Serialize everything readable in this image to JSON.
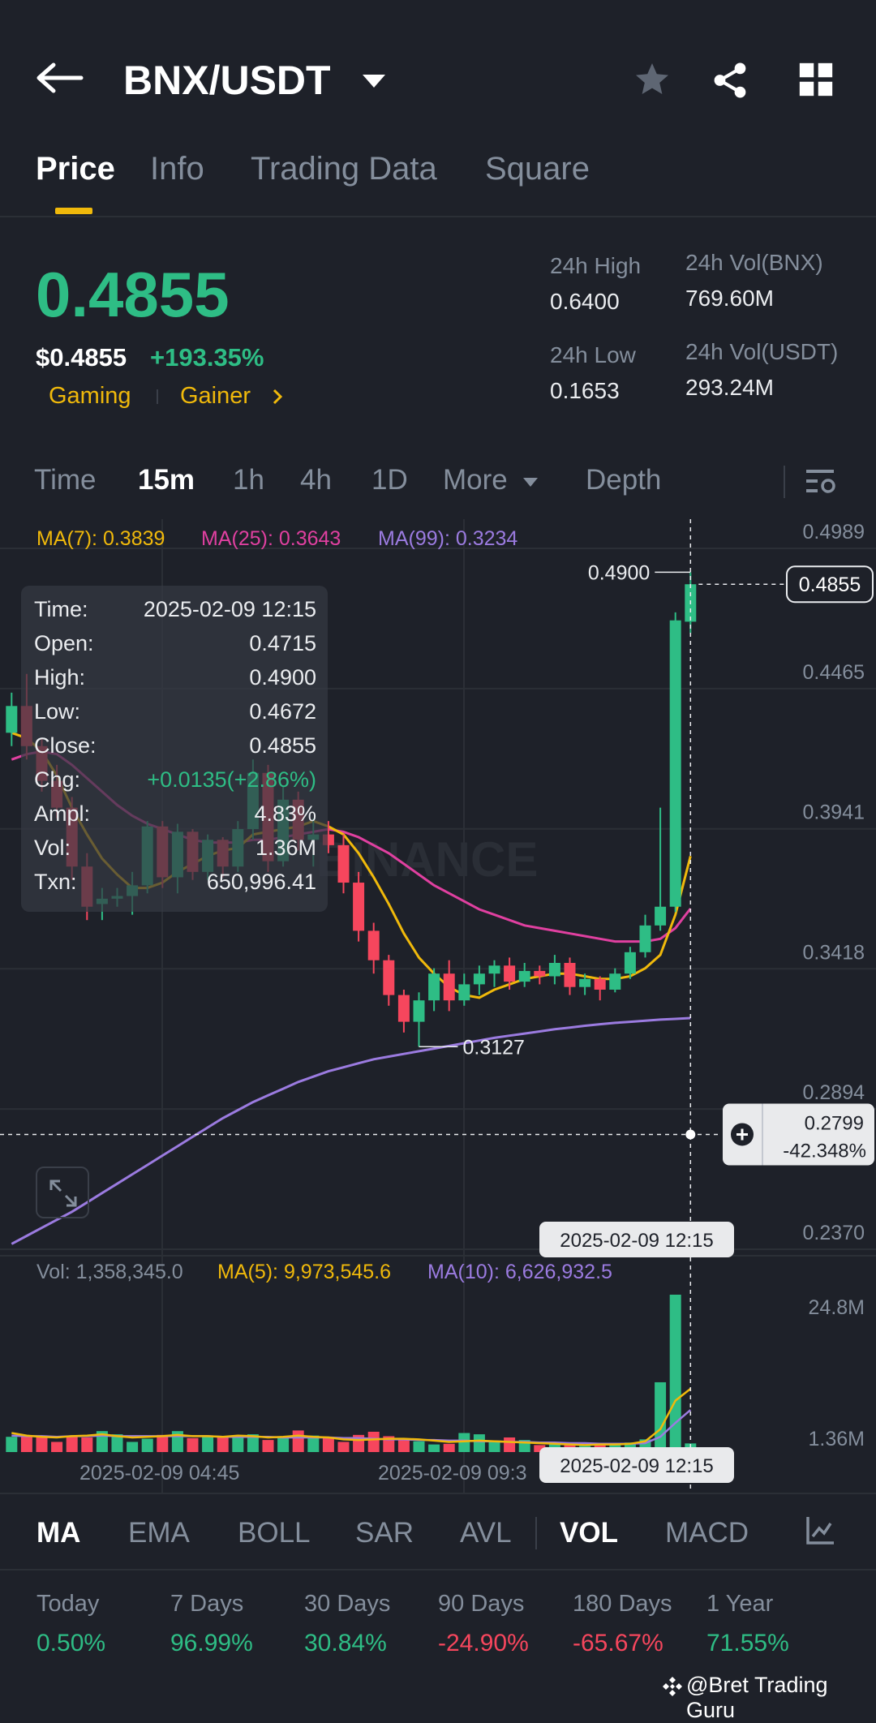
{
  "header": {
    "pair": "BNX/USDT"
  },
  "tabs": [
    {
      "label": "Price",
      "active": true
    },
    {
      "label": "Info",
      "active": false
    },
    {
      "label": "Trading Data",
      "active": false
    },
    {
      "label": "Square",
      "active": false
    }
  ],
  "ticker": {
    "last_price": "0.4855",
    "usd_price": "$0.4855",
    "change": "+193.35%",
    "tags": [
      "Gaming",
      "Gainer"
    ],
    "high_label": "24h High",
    "high": "0.6400",
    "low_label": "24h Low",
    "low": "0.1653",
    "vol_base_label": "24h Vol(BNX)",
    "vol_base": "769.60M",
    "vol_quote_label": "24h Vol(USDT)",
    "vol_quote": "293.24M"
  },
  "timeframes": {
    "items": [
      "Time",
      "15m",
      "1h",
      "4h",
      "1D",
      "More",
      "Depth"
    ],
    "active": "15m"
  },
  "ma_legend": {
    "ma7": "MA(7): 0.3839",
    "ma25": "MA(25): 0.3643",
    "ma99": "MA(99): 0.3234"
  },
  "colors": {
    "up": "#2ebd85",
    "down": "#f6465d",
    "ma7": "#f0b90b",
    "ma25": "#e040a0",
    "ma99": "#9b7be0",
    "accent": "#f0b90b"
  },
  "tooltip": {
    "rows": [
      {
        "label": "Time:",
        "value": "2025-02-09 12:15"
      },
      {
        "label": "Open:",
        "value": "0.4715"
      },
      {
        "label": "High:",
        "value": "0.4900"
      },
      {
        "label": "Low:",
        "value": "0.4672"
      },
      {
        "label": "Close:",
        "value": "0.4855"
      },
      {
        "label": "Chg:",
        "value": "+0.0135(+2.86%)"
      },
      {
        "label": "Ampl:",
        "value": "4.83%"
      },
      {
        "label": "Vol:",
        "value": "1.36M"
      },
      {
        "label": "Txn:",
        "value": "650,996.41"
      }
    ]
  },
  "chart_data": {
    "type": "candlestick",
    "watermark": "BINANCE",
    "price_axis_ticks": [
      "0.4989",
      "0.4465",
      "0.3941",
      "0.3418",
      "0.2894",
      "0.2370"
    ],
    "y_range": [
      0.237,
      0.4989
    ],
    "last_price_tag": "0.4855",
    "high_marker": "0.4900",
    "low_marker": "0.3127",
    "crosshair_price": "0.2799",
    "crosshair_pct": "-42.348%",
    "crosshair_time": "2025-02-09 12:15",
    "candles": [
      {
        "o": 0.43,
        "h": 0.445,
        "l": 0.425,
        "c": 0.44
      },
      {
        "o": 0.44,
        "h": 0.452,
        "l": 0.42,
        "c": 0.425
      },
      {
        "o": 0.425,
        "h": 0.428,
        "l": 0.408,
        "c": 0.412
      },
      {
        "o": 0.412,
        "h": 0.418,
        "l": 0.398,
        "c": 0.402
      },
      {
        "o": 0.402,
        "h": 0.406,
        "l": 0.375,
        "c": 0.38
      },
      {
        "o": 0.38,
        "h": 0.385,
        "l": 0.36,
        "c": 0.365
      },
      {
        "o": 0.366,
        "h": 0.372,
        "l": 0.36,
        "c": 0.368
      },
      {
        "o": 0.368,
        "h": 0.372,
        "l": 0.365,
        "c": 0.369
      },
      {
        "o": 0.369,
        "h": 0.378,
        "l": 0.362,
        "c": 0.373
      },
      {
        "o": 0.373,
        "h": 0.397,
        "l": 0.37,
        "c": 0.395
      },
      {
        "o": 0.395,
        "h": 0.397,
        "l": 0.372,
        "c": 0.376
      },
      {
        "o": 0.376,
        "h": 0.396,
        "l": 0.37,
        "c": 0.393
      },
      {
        "o": 0.393,
        "h": 0.394,
        "l": 0.375,
        "c": 0.378
      },
      {
        "o": 0.378,
        "h": 0.392,
        "l": 0.375,
        "c": 0.39
      },
      {
        "o": 0.39,
        "h": 0.391,
        "l": 0.376,
        "c": 0.38
      },
      {
        "o": 0.38,
        "h": 0.397,
        "l": 0.378,
        "c": 0.394
      },
      {
        "o": 0.394,
        "h": 0.42,
        "l": 0.39,
        "c": 0.415
      },
      {
        "o": 0.415,
        "h": 0.418,
        "l": 0.378,
        "c": 0.382
      },
      {
        "o": 0.382,
        "h": 0.41,
        "l": 0.38,
        "c": 0.405
      },
      {
        "o": 0.405,
        "h": 0.408,
        "l": 0.386,
        "c": 0.39
      },
      {
        "o": 0.39,
        "h": 0.398,
        "l": 0.38,
        "c": 0.392
      },
      {
        "o": 0.392,
        "h": 0.397,
        "l": 0.385,
        "c": 0.388
      },
      {
        "o": 0.388,
        "h": 0.392,
        "l": 0.37,
        "c": 0.374
      },
      {
        "o": 0.374,
        "h": 0.378,
        "l": 0.352,
        "c": 0.356
      },
      {
        "o": 0.356,
        "h": 0.359,
        "l": 0.34,
        "c": 0.345
      },
      {
        "o": 0.345,
        "h": 0.347,
        "l": 0.328,
        "c": 0.332
      },
      {
        "o": 0.332,
        "h": 0.334,
        "l": 0.318,
        "c": 0.322
      },
      {
        "o": 0.322,
        "h": 0.333,
        "l": 0.3127,
        "c": 0.33
      },
      {
        "o": 0.33,
        "h": 0.342,
        "l": 0.326,
        "c": 0.34
      },
      {
        "o": 0.34,
        "h": 0.345,
        "l": 0.326,
        "c": 0.33
      },
      {
        "o": 0.33,
        "h": 0.34,
        "l": 0.328,
        "c": 0.336
      },
      {
        "o": 0.336,
        "h": 0.343,
        "l": 0.332,
        "c": 0.34
      },
      {
        "o": 0.34,
        "h": 0.345,
        "l": 0.335,
        "c": 0.343
      },
      {
        "o": 0.343,
        "h": 0.346,
        "l": 0.334,
        "c": 0.337
      },
      {
        "o": 0.337,
        "h": 0.344,
        "l": 0.335,
        "c": 0.341
      },
      {
        "o": 0.341,
        "h": 0.343,
        "l": 0.336,
        "c": 0.339
      },
      {
        "o": 0.339,
        "h": 0.347,
        "l": 0.336,
        "c": 0.344
      },
      {
        "o": 0.344,
        "h": 0.346,
        "l": 0.332,
        "c": 0.335
      },
      {
        "o": 0.335,
        "h": 0.34,
        "l": 0.332,
        "c": 0.338
      },
      {
        "o": 0.338,
        "h": 0.339,
        "l": 0.33,
        "c": 0.334
      },
      {
        "o": 0.334,
        "h": 0.342,
        "l": 0.333,
        "c": 0.34
      },
      {
        "o": 0.34,
        "h": 0.35,
        "l": 0.338,
        "c": 0.348
      },
      {
        "o": 0.348,
        "h": 0.362,
        "l": 0.346,
        "c": 0.358
      },
      {
        "o": 0.358,
        "h": 0.402,
        "l": 0.356,
        "c": 0.365
      },
      {
        "o": 0.365,
        "h": 0.475,
        "l": 0.363,
        "c": 0.472
      },
      {
        "o": 0.4715,
        "h": 0.49,
        "l": 0.4672,
        "c": 0.4855
      }
    ],
    "ma7": [
      0.43,
      0.428,
      0.423,
      0.414,
      0.402,
      0.392,
      0.383,
      0.377,
      0.372,
      0.372,
      0.374,
      0.378,
      0.381,
      0.384,
      0.386,
      0.387,
      0.392,
      0.393,
      0.394,
      0.395,
      0.397,
      0.395,
      0.392,
      0.385,
      0.376,
      0.366,
      0.355,
      0.346,
      0.34,
      0.335,
      0.332,
      0.331,
      0.334,
      0.336,
      0.338,
      0.339,
      0.34,
      0.34,
      0.339,
      0.338,
      0.338,
      0.339,
      0.342,
      0.347,
      0.362,
      0.3839
    ],
    "ma25": [
      0.42,
      0.422,
      0.423,
      0.422,
      0.418,
      0.413,
      0.408,
      0.403,
      0.399,
      0.396,
      0.394,
      0.392,
      0.39,
      0.389,
      0.389,
      0.389,
      0.39,
      0.39,
      0.391,
      0.392,
      0.393,
      0.394,
      0.393,
      0.391,
      0.388,
      0.385,
      0.381,
      0.377,
      0.373,
      0.37,
      0.367,
      0.364,
      0.362,
      0.36,
      0.358,
      0.357,
      0.356,
      0.355,
      0.354,
      0.353,
      0.352,
      0.352,
      0.352,
      0.353,
      0.357,
      0.3643
    ],
    "ma99": [
      0.239,
      0.242,
      0.245,
      0.248,
      0.251,
      0.2545,
      0.258,
      0.2615,
      0.265,
      0.2685,
      0.272,
      0.2755,
      0.279,
      0.2825,
      0.286,
      0.289,
      0.292,
      0.2945,
      0.297,
      0.2995,
      0.3015,
      0.3035,
      0.305,
      0.3065,
      0.308,
      0.309,
      0.31,
      0.311,
      0.312,
      0.313,
      0.314,
      0.315,
      0.316,
      0.3168,
      0.3176,
      0.3184,
      0.3192,
      0.3198,
      0.3205,
      0.3211,
      0.3216,
      0.322,
      0.3224,
      0.3228,
      0.3231,
      0.3234
    ],
    "x_labels": [
      "2025-02-09 04:45",
      "2025-02-09 09:3"
    ],
    "volume": {
      "legend_vol": "Vol: 1,358,345.0",
      "legend_ma5": "MA(5): 9,973,545.6",
      "legend_ma10": "MA(10): 6,626,932.5",
      "ticks": [
        "24.8M",
        "1.36M"
      ],
      "values": [
        2.4,
        2.5,
        2.6,
        1.6,
        2.6,
        2.3,
        3.3,
        2.8,
        1.6,
        2.1,
        2.7,
        3.3,
        2.2,
        2.6,
        2.3,
        2.6,
        2.8,
        1.9,
        2.3,
        3.4,
        2.6,
        2.3,
        1.6,
        2.7,
        3.2,
        2.5,
        2.1,
        1.7,
        1.2,
        1.3,
        3.0,
        2.8,
        1.7,
        2.3,
        1.9,
        1.1,
        1.3,
        1.1,
        1.0,
        1.4,
        1.2,
        1.5,
        2.0,
        11.0,
        24.8,
        1.36
      ],
      "ma5": [
        3.0,
        2.6,
        2.4,
        2.3,
        2.5,
        2.6,
        2.8,
        2.5,
        2.3,
        2.4,
        2.5,
        2.7,
        2.5,
        2.5,
        2.4,
        2.6,
        2.5,
        2.3,
        2.4,
        2.6,
        2.4,
        2.3,
        2.0,
        1.9,
        2.0,
        2.1,
        2.1,
        2.0,
        1.8,
        1.6,
        1.7,
        1.8,
        1.7,
        1.6,
        1.5,
        1.4,
        1.3,
        1.2,
        1.1,
        1.2,
        1.2,
        1.3,
        1.7,
        3.6,
        8.1,
        9.97
      ],
      "ma10": [
        2.6,
        2.5,
        2.5,
        2.4,
        2.5,
        2.5,
        2.6,
        2.5,
        2.5,
        2.5,
        2.5,
        2.5,
        2.5,
        2.5,
        2.4,
        2.4,
        2.4,
        2.4,
        2.3,
        2.3,
        2.3,
        2.3,
        2.2,
        2.2,
        2.1,
        2.0,
        2.0,
        1.9,
        1.9,
        1.8,
        1.8,
        1.7,
        1.7,
        1.6,
        1.6,
        1.5,
        1.5,
        1.4,
        1.4,
        1.3,
        1.3,
        1.3,
        1.4,
        2.4,
        4.6,
        6.63
      ]
    },
    "x_time_tag": "2025-02-09 12:15"
  },
  "indicators": {
    "items": [
      "MA",
      "EMA",
      "BOLL",
      "SAR",
      "AVL",
      "VOL",
      "MACD"
    ],
    "active": [
      "MA",
      "VOL"
    ]
  },
  "performance": [
    {
      "label": "Today",
      "value": "0.50%",
      "up": true
    },
    {
      "label": "7 Days",
      "value": "96.99%",
      "up": true
    },
    {
      "label": "30 Days",
      "value": "30.84%",
      "up": true
    },
    {
      "label": "90 Days",
      "value": "-24.90%",
      "up": false
    },
    {
      "label": "180 Days",
      "value": "-65.67%",
      "up": false
    },
    {
      "label": "1 Year",
      "value": "71.55%",
      "up": true
    }
  ],
  "watermark_credit": "@Bret Trading Guru"
}
